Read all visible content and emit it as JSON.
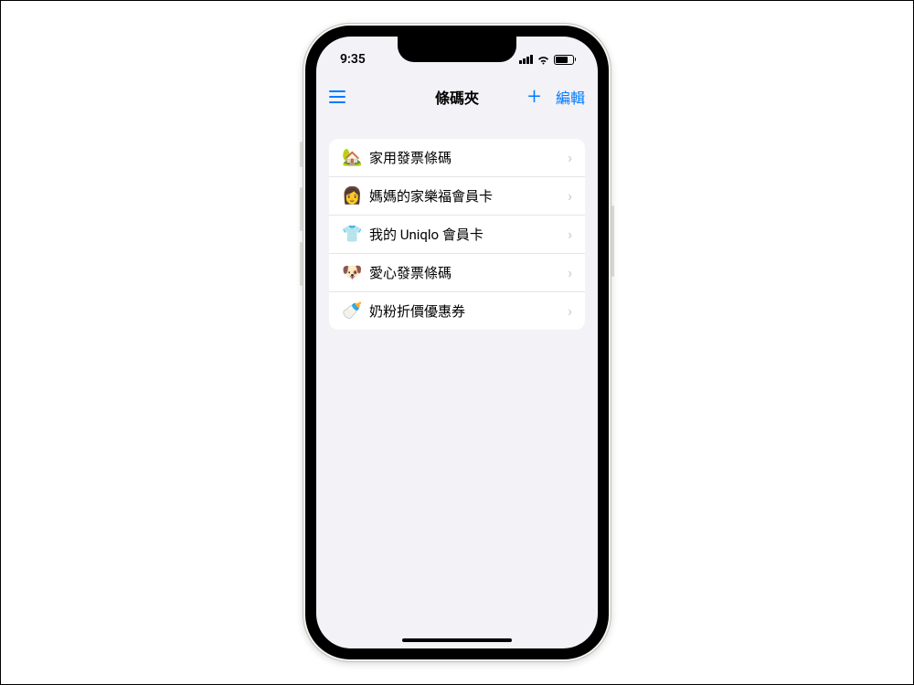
{
  "statusBar": {
    "time": "9:35"
  },
  "nav": {
    "title": "條碼夾",
    "addLabel": "+",
    "editLabel": "編輯"
  },
  "cards": [
    {
      "icon": "🏡",
      "label": "家用發票條碼"
    },
    {
      "icon": "👩",
      "label": "媽媽的家樂福會員卡"
    },
    {
      "icon": "👕",
      "label": "我的 Uniqlo 會員卡"
    },
    {
      "icon": "🐶",
      "label": "愛心發票條碼"
    },
    {
      "icon": "🍼",
      "label": "奶粉折價優惠券"
    }
  ]
}
